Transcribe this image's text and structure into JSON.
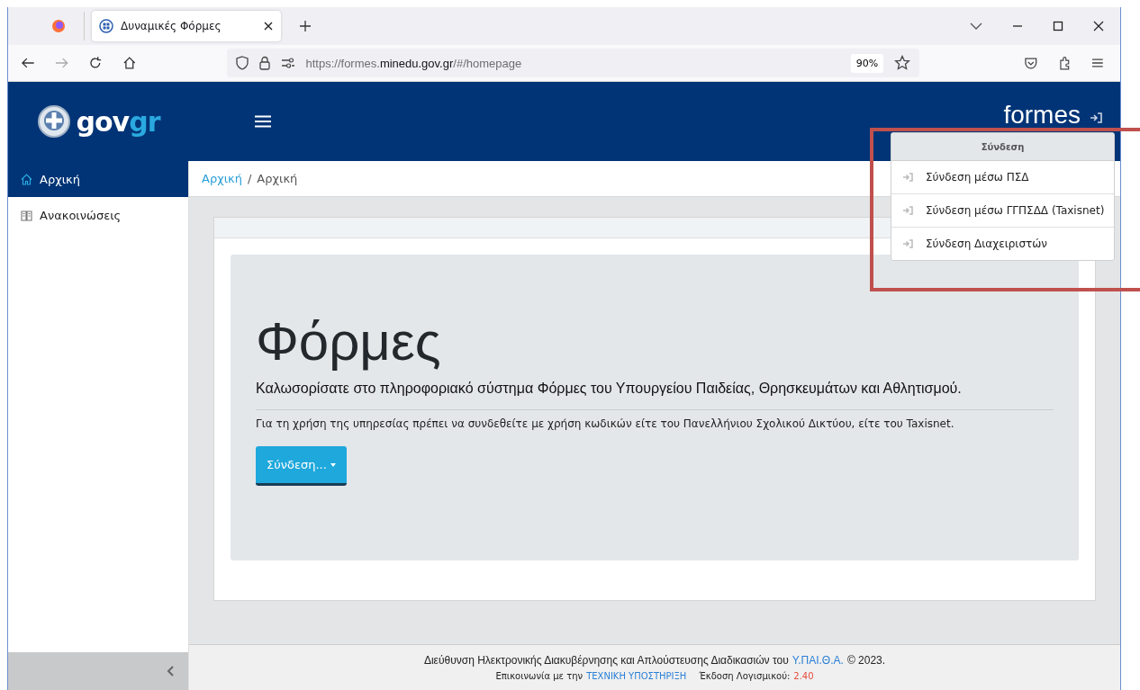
{
  "browser": {
    "tab": {
      "title": "Δυναμικές Φόρμες",
      "selected": true
    },
    "url": {
      "prefix": "https://formes.",
      "host": "minedu.gov.gr",
      "path": "/#/homepage"
    },
    "zoom": "90%"
  },
  "header": {
    "logo": {
      "gov": "gov",
      "gr": "gr"
    },
    "app_logo": "formes"
  },
  "sidebar": {
    "items": [
      {
        "label": "Αρχική",
        "kind": "home",
        "selected": true
      },
      {
        "label": "Ανακοινώσεις",
        "kind": "book",
        "selected": false
      }
    ]
  },
  "breadcrumb": {
    "items": [
      {
        "label": "Αρχική",
        "link": true
      },
      {
        "label": "Αρχική",
        "link": false
      }
    ],
    "separator": "/"
  },
  "hero": {
    "title": "Φόρμες",
    "lead": "Καλωσορίσατε στο πληροφοριακό σύστημα Φόρμες του Υπουργείου Παιδείας, Θρησκευμάτων και Αθλητισμού.",
    "text": "Για τη χρήση της υπηρεσίας πρέπει να συνδεθείτε με χρήση κωδικών είτε του Πανελλήνιου Σχολικού Δικτύου, είτε του Taxisnet.",
    "button": "Σύνδεση..."
  },
  "login_menu": {
    "header": "Σύνδεση",
    "items": [
      "Σύνδεση μέσω ΠΣΔ",
      "Σύνδεση μέσω ΓΓΠΣΔΔ (Taxisnet)",
      "Σύνδεση Διαχειριστών"
    ]
  },
  "footer": {
    "line1": {
      "text": "Διεύθυνση Ηλεκτρονικής Διακυβέρνησης και Απλούστευσης Διαδικασιών του",
      "link": "Υ.ΠΑΙ.Θ.Α.",
      "suffix": "© 2023."
    },
    "line2": {
      "text": "Επικοινωνία με την",
      "link": "ΤΕΧΝΙΚΗ ΥΠΟΣΤΗΡΙΞΗ",
      "version_label": "Έκδοση Λογισμικού:",
      "version": "2.40"
    }
  }
}
